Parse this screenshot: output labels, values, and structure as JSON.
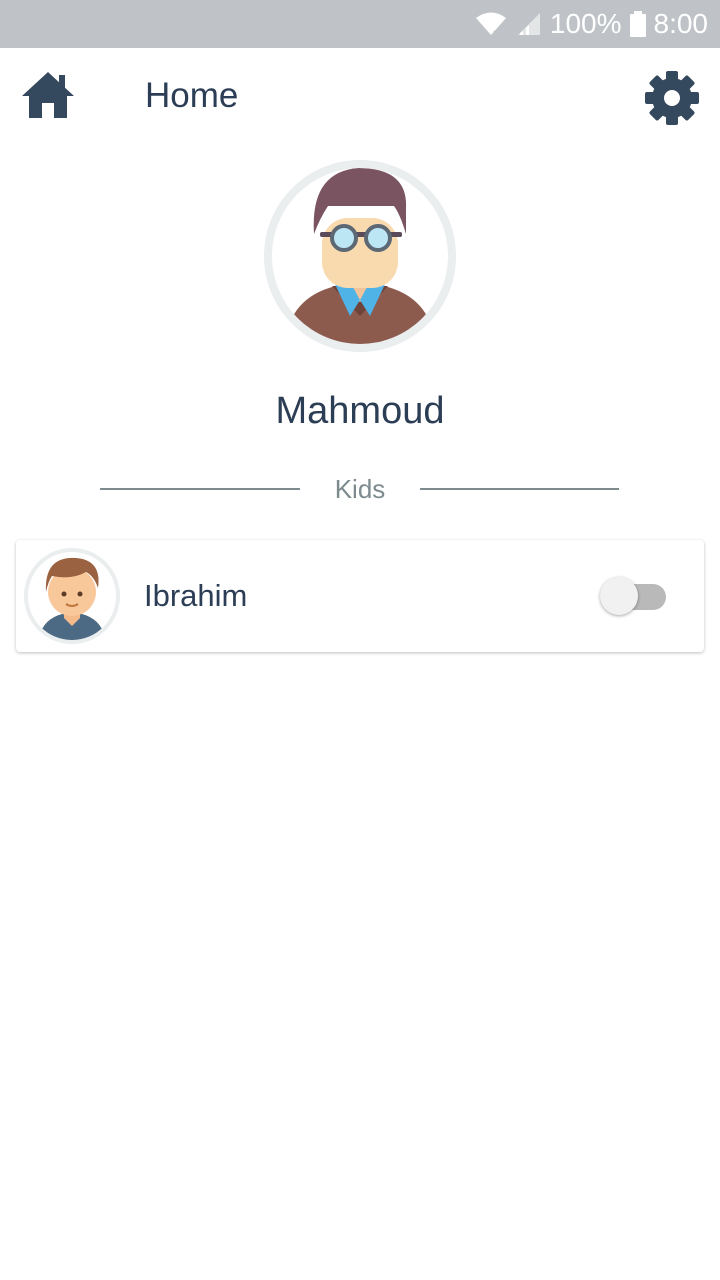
{
  "status_bar": {
    "battery_text": "100%",
    "time": "8:00",
    "icons": [
      "wifi-icon",
      "signal-icon",
      "battery-icon"
    ]
  },
  "app_bar": {
    "title": "Home",
    "left_icon": "home-icon",
    "right_icon": "gear-icon"
  },
  "profile": {
    "name": "Mahmoud",
    "avatar": "man-with-glasses-avatar"
  },
  "kids_section": {
    "label": "Kids",
    "items": [
      {
        "name": "Ibrahim",
        "avatar": "boy-avatar",
        "toggle_on": false
      }
    ]
  },
  "colors": {
    "primary_text": "#2c3e55",
    "status_bar": "#bfc3c7",
    "divider": "#7d8a8e"
  }
}
